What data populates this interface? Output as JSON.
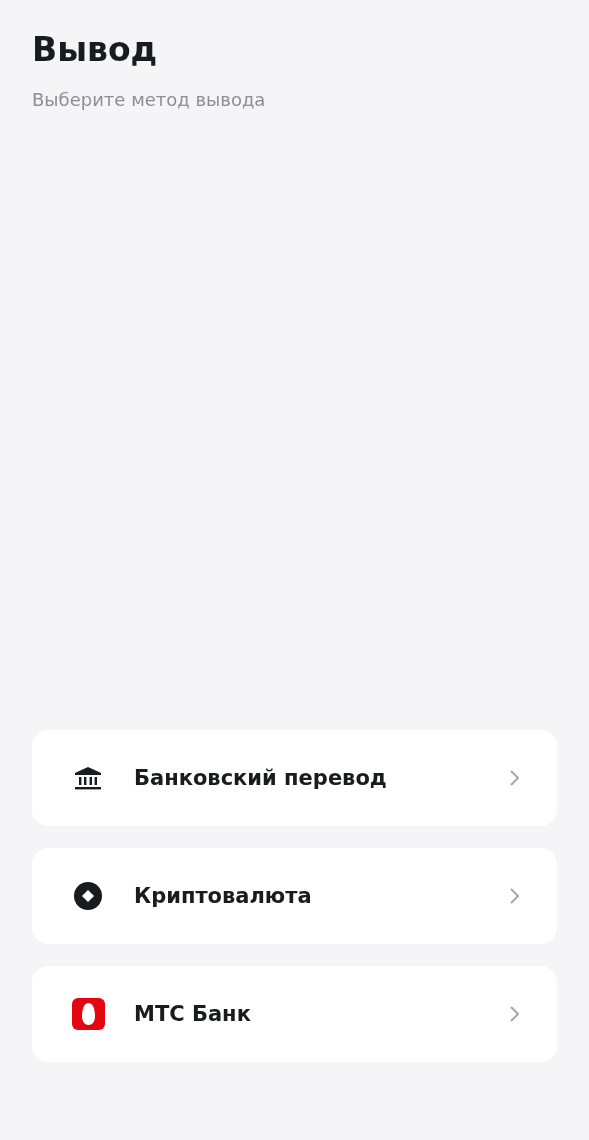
{
  "header": {
    "title": "Вывод",
    "subtitle": "Выберите метод вывода"
  },
  "methods": [
    {
      "kind": "bank",
      "label": "Банковский перевод"
    },
    {
      "kind": "crypto",
      "label": "Криптовалюта"
    },
    {
      "kind": "mts",
      "label": "МТС Банк"
    }
  ]
}
